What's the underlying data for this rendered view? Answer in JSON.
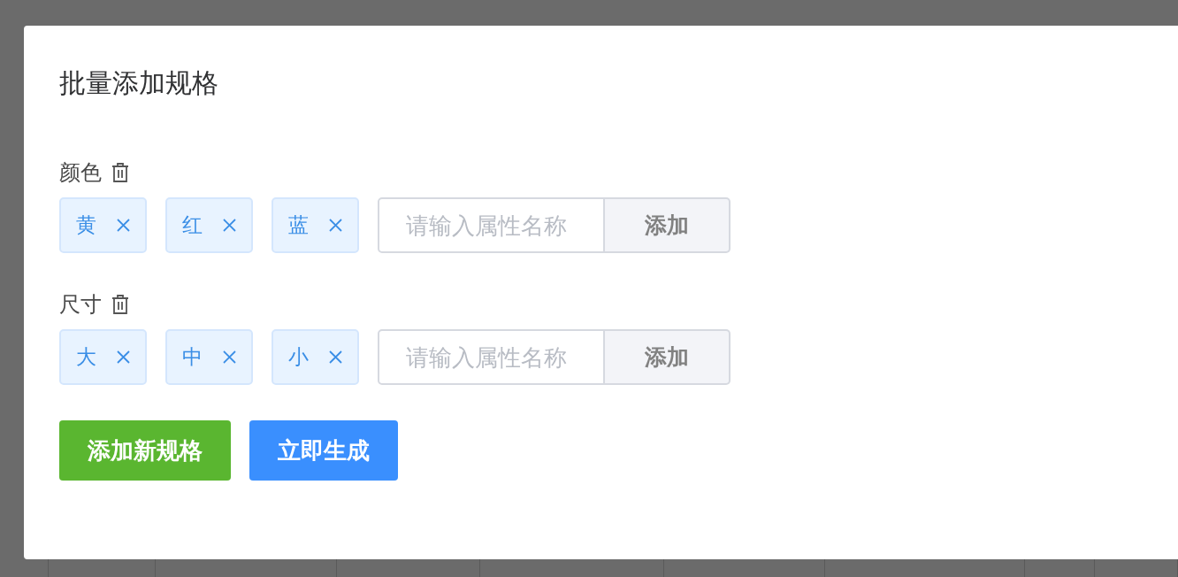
{
  "dialog": {
    "title": "批量添加规格"
  },
  "specs": [
    {
      "name": "颜色",
      "values": [
        "黄",
        "红",
        "蓝"
      ],
      "input": {
        "placeholder": "请输入属性名称"
      },
      "add_button": "添加"
    },
    {
      "name": "尺寸",
      "values": [
        "大",
        "中",
        "小"
      ],
      "input": {
        "placeholder": "请输入属性名称"
      },
      "add_button": "添加"
    }
  ],
  "buttons": [
    {
      "label": "添加新规格",
      "kind": "success"
    },
    {
      "label": "立即生成",
      "kind": "primary"
    }
  ]
}
